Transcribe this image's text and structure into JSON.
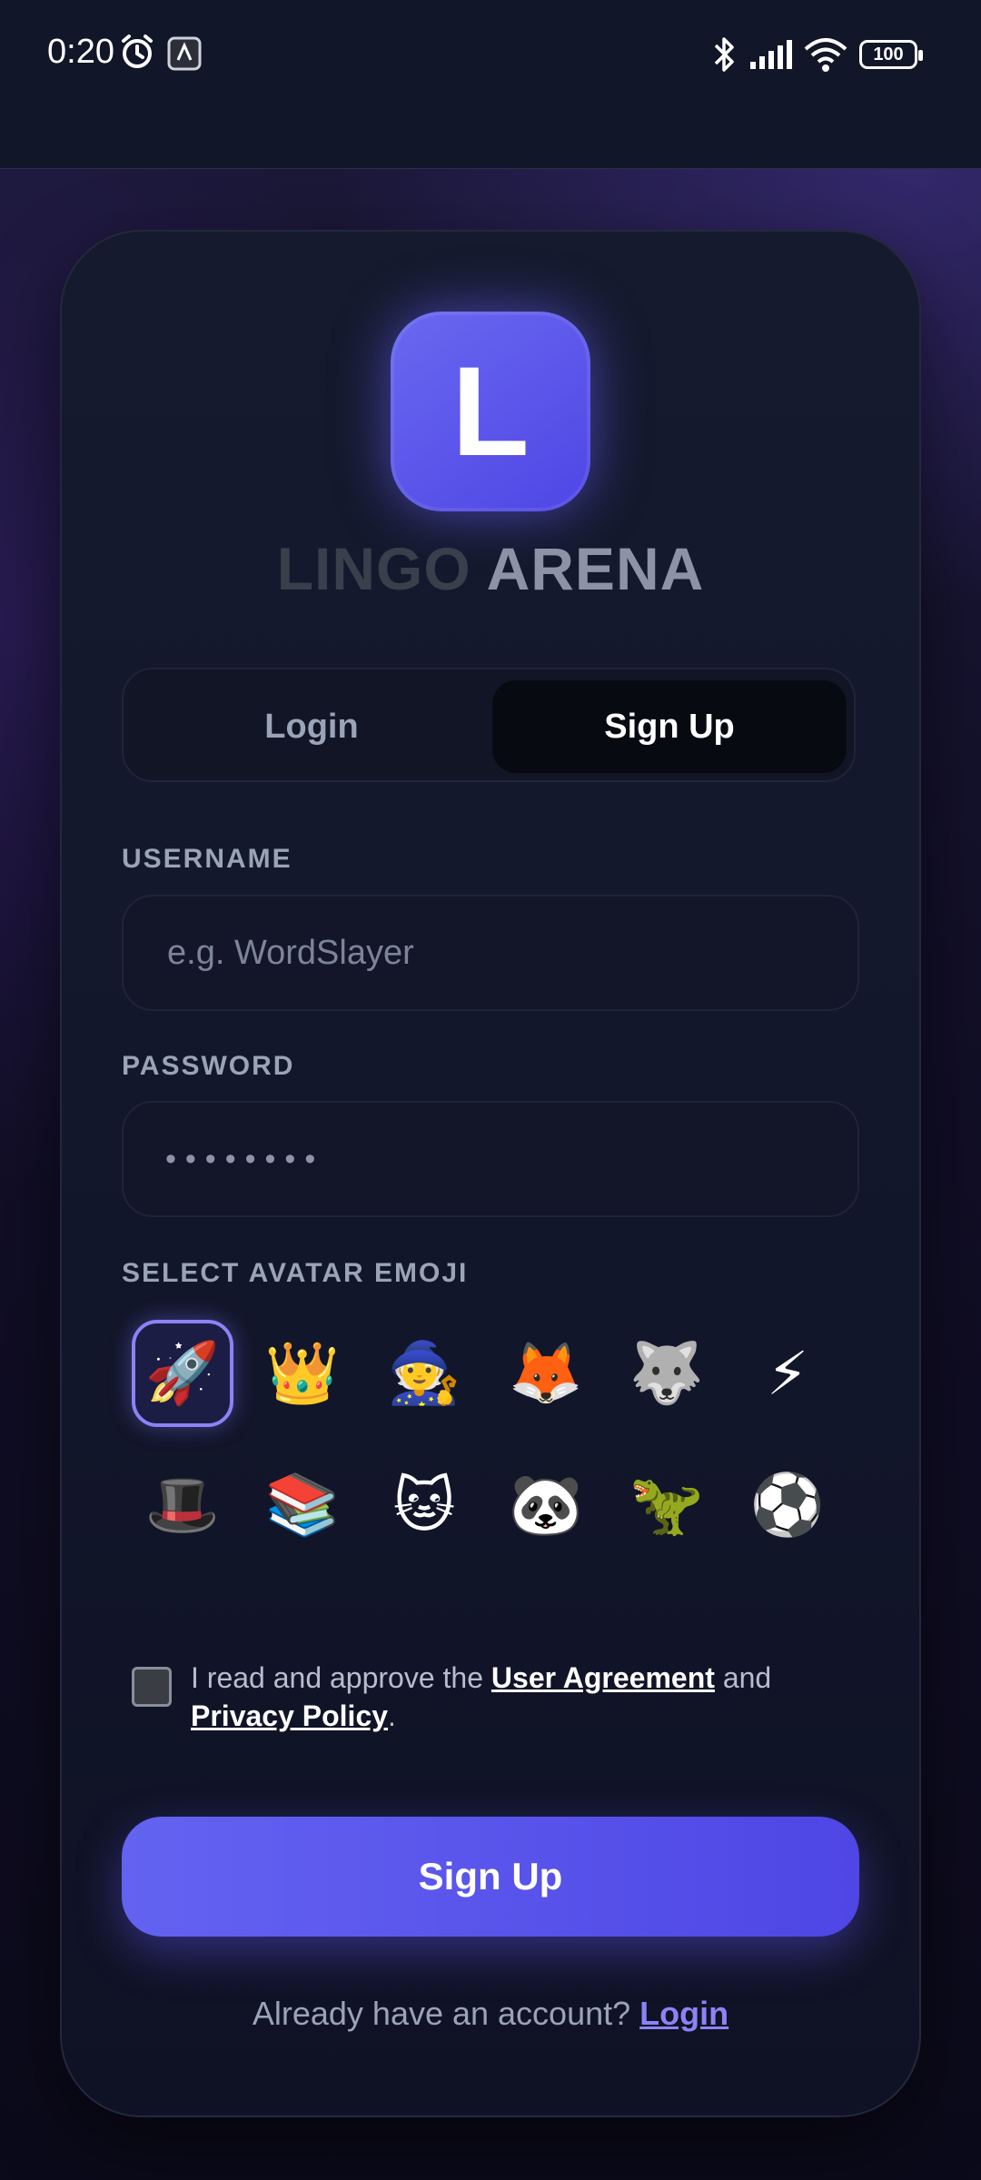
{
  "status_bar": {
    "time": "0:20",
    "battery": "100",
    "icons": [
      "alarm-icon",
      "app-notification-icon",
      "bluetooth-icon",
      "signal-icon",
      "wifi-icon",
      "battery-icon"
    ]
  },
  "brand": {
    "logo_letter": "L",
    "name_part1": "LINGO",
    "name_part2": "ARENA"
  },
  "tabs": [
    {
      "label": "Login",
      "active": false
    },
    {
      "label": "Sign Up",
      "active": true
    }
  ],
  "form": {
    "username_label": "USERNAME",
    "username_placeholder": "e.g. WordSlayer",
    "username_value": "",
    "password_label": "PASSWORD",
    "password_value": "••••••••",
    "avatar_label": "SELECT AVATAR EMOJI",
    "avatars": [
      "🚀",
      "👑",
      "🧙",
      "🦊",
      "🐺",
      "⚡",
      "🎩",
      "📚",
      "🐱",
      "🐼",
      "🦖",
      "⚽"
    ],
    "selected_avatar": "🚀"
  },
  "agreement": {
    "checked": false,
    "prefix": "I read and approve the ",
    "user_agreement": "User Agreement",
    "middle": " and ",
    "privacy_policy": "Privacy Policy",
    "suffix": "."
  },
  "submit_label": "Sign Up",
  "footer": {
    "text": "Already have an account? ",
    "link": "Login"
  },
  "colors": {
    "accent": "#5b57ec",
    "accent_light": "#8b83f5",
    "card_bg": "#141a2e",
    "background": "#0b0a1a"
  }
}
